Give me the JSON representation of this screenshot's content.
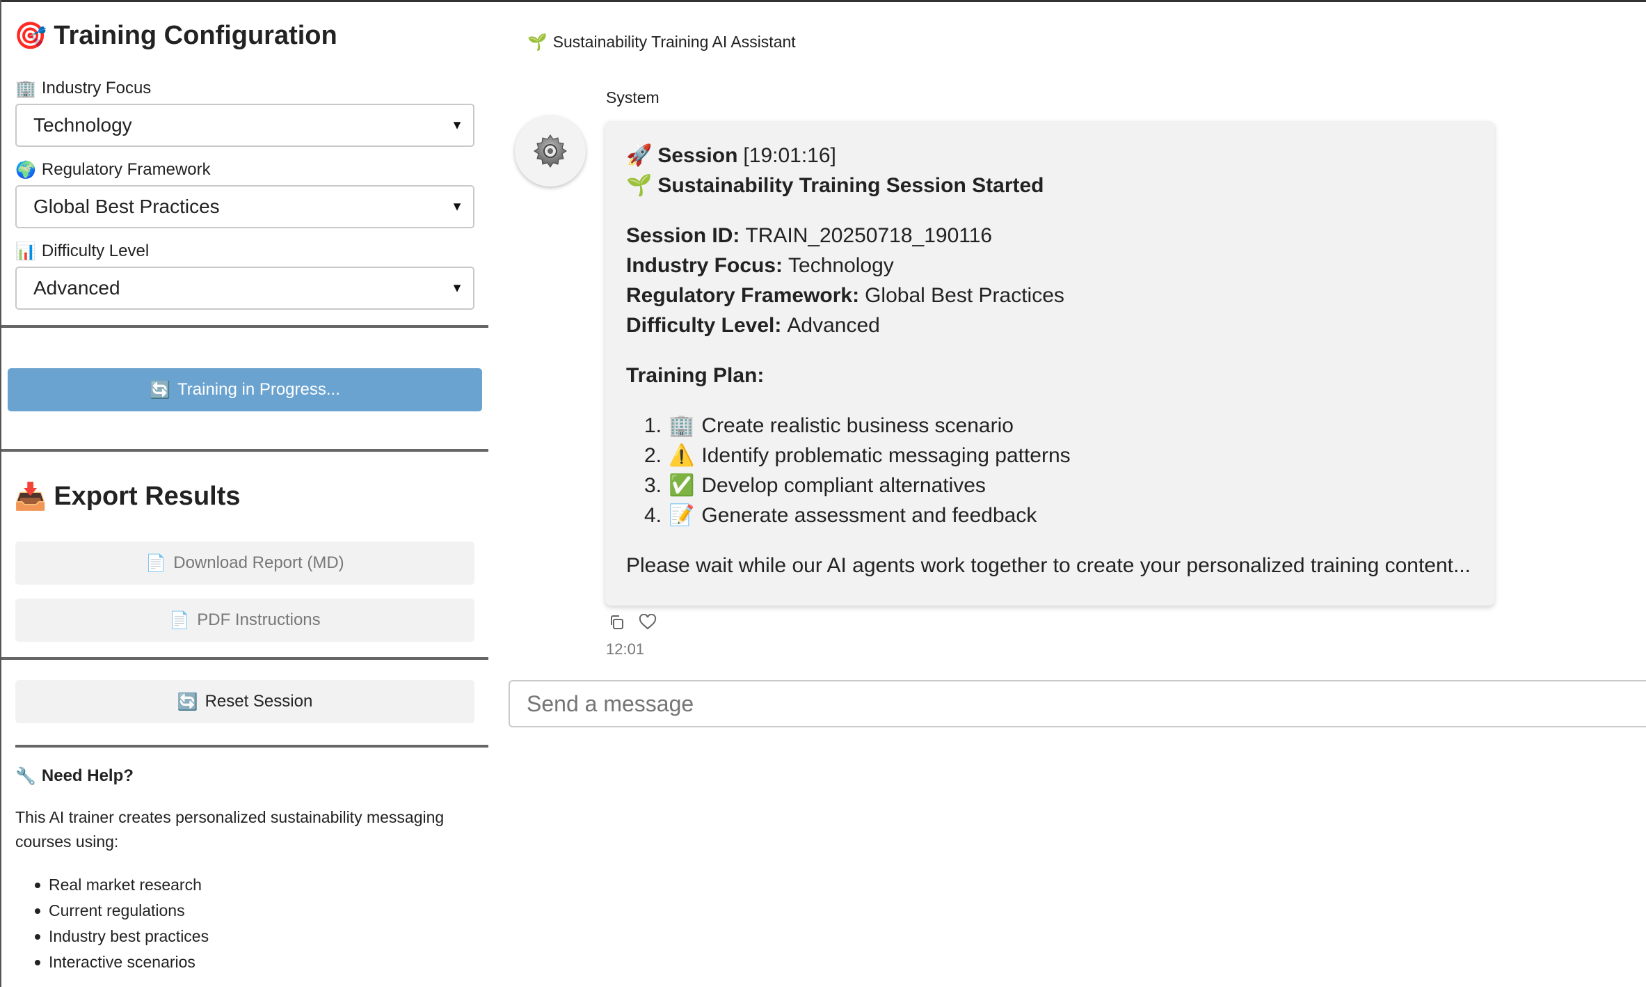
{
  "sidebar": {
    "title": "Training Configuration",
    "title_icon": "🎯",
    "industry": {
      "label": "Industry Focus",
      "icon": "🏢",
      "value": "Technology"
    },
    "regulatory": {
      "label": "Regulatory Framework",
      "icon": "🌍",
      "value": "Global Best Practices"
    },
    "difficulty": {
      "label": "Difficulty Level",
      "icon": "📊",
      "value": "Advanced"
    },
    "train_button": {
      "label": "Training in Progress...",
      "icon": "🔄"
    },
    "export": {
      "title": "Export Results",
      "title_icon": "📥",
      "download_label": "Download Report (MD)",
      "download_icon": "📄",
      "pdf_label": "PDF Instructions",
      "pdf_icon": "📄"
    },
    "reset_button": {
      "label": "Reset Session",
      "icon": "🔄"
    },
    "help": {
      "title": "Need Help?",
      "icon": "🔧",
      "text": "This AI trainer creates personalized sustainability messaging courses using:",
      "items": [
        "Real market research",
        "Current regulations",
        "Industry best practices",
        "Interactive scenarios"
      ]
    }
  },
  "chat": {
    "header": "Sustainability Training AI Assistant",
    "header_icon": "🌱",
    "sender": "System",
    "message": {
      "session_icon": "🚀",
      "session_label": "Session",
      "session_time": "[19:01:16]",
      "started_icon": "🌱",
      "started_text": "Sustainability Training Session Started",
      "fields": [
        {
          "key": "Session ID:",
          "value": "TRAIN_20250718_190116"
        },
        {
          "key": "Industry Focus:",
          "value": "Technology"
        },
        {
          "key": "Regulatory Framework:",
          "value": "Global Best Practices"
        },
        {
          "key": "Difficulty Level:",
          "value": "Advanced"
        }
      ],
      "plan_title": "Training Plan:",
      "plan": [
        {
          "num": "1.",
          "icon": "🏢",
          "text": "Create realistic business scenario"
        },
        {
          "num": "2.",
          "icon": "⚠️",
          "text": "Identify problematic messaging patterns"
        },
        {
          "num": "3.",
          "icon": "✅",
          "text": "Develop compliant alternatives"
        },
        {
          "num": "4.",
          "icon": "📝",
          "text": "Generate assessment and feedback"
        }
      ],
      "footer": "Please wait while our AI agents work together to create your personalized training content..."
    },
    "timestamp": "12:01",
    "input_placeholder": "Send a message"
  },
  "colors": {
    "train_button_bg": "#6aa3d0",
    "bubble_bg": "#f2f2f2",
    "divider": "#666666"
  }
}
